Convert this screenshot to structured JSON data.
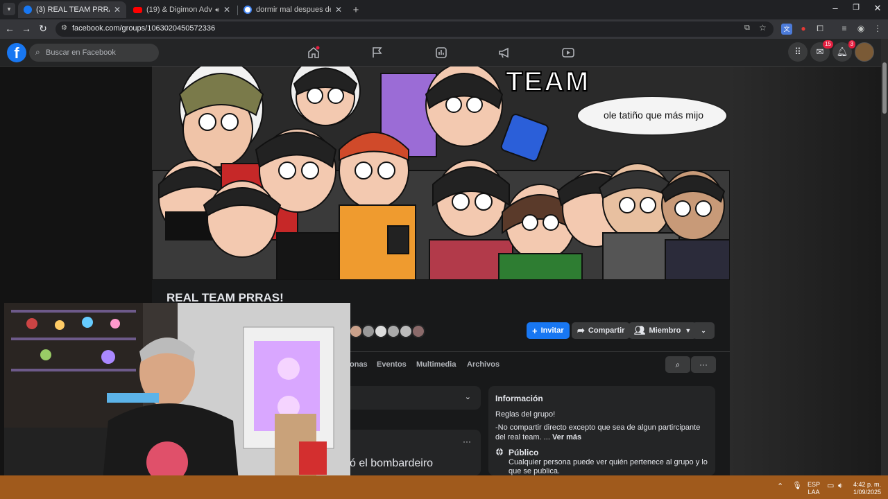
{
  "browser": {
    "tabs": [
      {
        "title": "(3) REAL TEAM PRRAS! | Faceb",
        "active": true,
        "favicon_color": "#1877f2"
      },
      {
        "title": "(19) & Digimon Adventure",
        "active": false,
        "favicon_color": "#ff0000"
      },
      {
        "title": "dormir mal despues de los 30 a",
        "active": false,
        "favicon_color": "#ffffff"
      }
    ],
    "url": "facebook.com/groups/1063020450572336"
  },
  "facebook": {
    "search_placeholder": "Buscar en Facebook",
    "messenger_badge": "15",
    "notifications_badge": "3",
    "accent": "#1877f2"
  },
  "cover": {
    "header_text": "TEAM",
    "bubble_text": "ole tatiño que más mijo"
  },
  "group": {
    "name": "REAL TEAM PRRAS!",
    "buttons": {
      "invite": "Invitar",
      "share": "Compartir",
      "member": "Miembro"
    },
    "tabs": [
      "onas",
      "Eventos",
      "Multimedia",
      "Archivos"
    ]
  },
  "info": {
    "title": "Información",
    "rules_title": "Reglas del grupo!",
    "rules_text": "-No compartir directo excepto que sea de algun partircipante del real team. ...",
    "see_more": "Ver más",
    "public_title": "Público",
    "public_desc": "Cualquier persona puede ver quién pertenece al grupo y lo que se publica."
  },
  "post_fragment": "ó el bombardeiro",
  "taskbar": {
    "lang_top": "ESP",
    "lang_bottom": "LAA",
    "time": "4:42 p. m.",
    "date": "1/09/2025"
  }
}
